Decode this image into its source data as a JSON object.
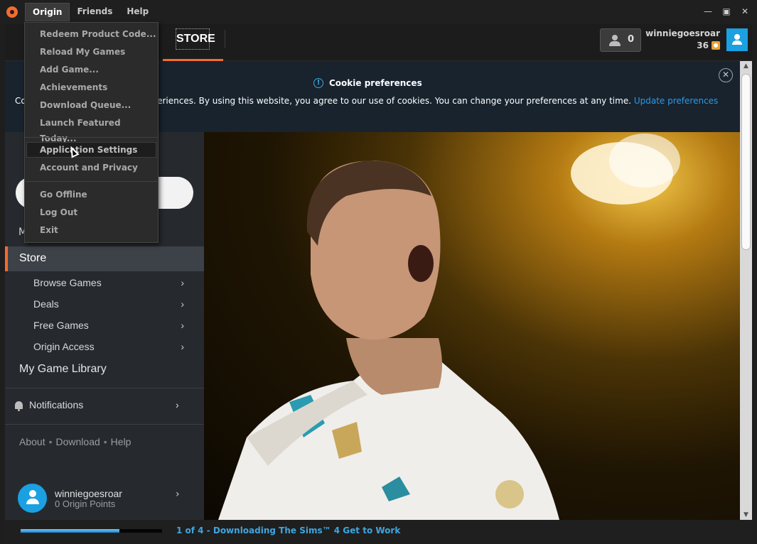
{
  "menubar": {
    "items": [
      "Origin",
      "Friends",
      "Help"
    ]
  },
  "window": {
    "minimize_icon": "minimize-icon",
    "maximize_icon": "maximize-icon",
    "close_icon": "close-icon"
  },
  "header": {
    "store_tab": "STORE",
    "friends_count": "0",
    "username": "winniegoesroar",
    "points": "36"
  },
  "cookie": {
    "title": "Cookie preferences",
    "text_lead": "Co",
    "text": "and provide personalized experiences. By using this website, you agree to our use of cookies. You can change your preferences at any time.",
    "link": "Update preferences"
  },
  "sidebar": {
    "partial_item": "M",
    "store": "Store",
    "subitems": [
      {
        "label": "Browse Games"
      },
      {
        "label": "Deals"
      },
      {
        "label": "Free Games"
      },
      {
        "label": "Origin Access"
      }
    ],
    "library": "My Game Library",
    "notifications": "Notifications",
    "footer": {
      "about": "About",
      "download": "Download",
      "help": "Help",
      "separator": "•"
    },
    "user": {
      "name": "winniegoesroar",
      "points": "0 Origin Points"
    }
  },
  "status": {
    "text": "1 of 4 - Downloading The Sims™ 4 Get to Work",
    "progress": 0.7
  },
  "dropdown": {
    "group1": [
      "Redeem Product Code...",
      "Reload My Games",
      "Add Game...",
      "Achievements",
      "Download Queue...",
      "Launch Featured Today..."
    ],
    "group2": [
      "Application Settings",
      "Account and Privacy"
    ],
    "group3": [
      "Go Offline",
      "Log Out",
      "Exit"
    ],
    "hovered": "Application Settings"
  },
  "colors": {
    "accent": "#f56c2d",
    "link": "#2c9ae6",
    "avatar": "#1ba0e2"
  }
}
